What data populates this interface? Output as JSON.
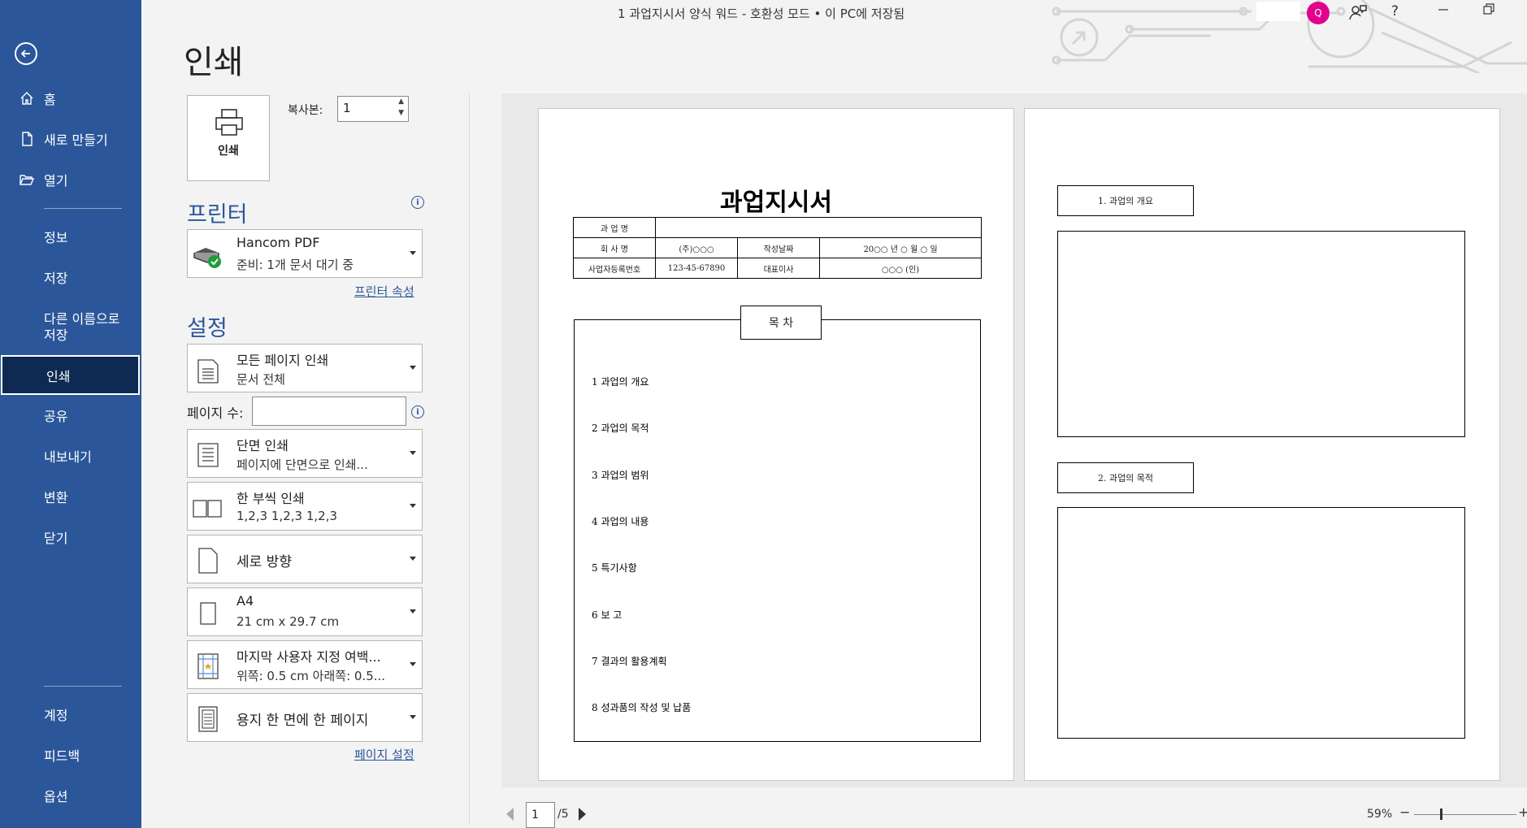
{
  "window": {
    "title": "1 과업지시서 양식 워드  -  호환성 모드 • 이 PC에 저장됨",
    "help_label": "?",
    "avatar_glyph": "Q"
  },
  "sidebar": {
    "items": [
      {
        "label": "홈",
        "icon": "home-icon"
      },
      {
        "label": "새로 만들기",
        "icon": "new-document-icon"
      },
      {
        "label": "열기",
        "icon": "folder-open-icon"
      },
      {
        "label": "정보"
      },
      {
        "label": "저장"
      },
      {
        "label_line1": "다른 이름으로",
        "label_line2": "저장"
      },
      {
        "label": "인쇄",
        "active": true
      },
      {
        "label": "공유"
      },
      {
        "label": "내보내기"
      },
      {
        "label": "변환"
      },
      {
        "label": "닫기"
      },
      {
        "label": "계정"
      },
      {
        "label": "피드백"
      },
      {
        "label": "옵션"
      }
    ]
  },
  "print_panel": {
    "heading": "인쇄",
    "print_button_label": "인쇄",
    "copies_label": "복사본:",
    "copies_value": "1",
    "printer_heading": "프린터",
    "printer_name": "Hancom PDF",
    "printer_status": "준비: 1개 문서 대기 중",
    "printer_properties_link": "프린터 속성",
    "settings_heading": "설정",
    "settings": [
      {
        "line1": "모든 페이지 인쇄",
        "line2": "문서 전체"
      },
      {
        "line1": "단면 인쇄",
        "line2": "페이지에 단면으로 인쇄..."
      },
      {
        "line1": "한 부씩 인쇄",
        "line2": "1,2,3     1,2,3     1,2,3"
      },
      {
        "single": "세로 방향"
      },
      {
        "line1": "A4",
        "line2": "21 cm x 29.7 cm"
      },
      {
        "line1": "마지막 사용자 지정 여백...",
        "line2": "위쪽: 0.5 cm 아래쪽: 0.5..."
      },
      {
        "single": "용지 한 면에 한 페이지"
      }
    ],
    "pages_label": "페이지 수:",
    "pages_value": "",
    "page_setup_link": "페이지 설정"
  },
  "preview": {
    "page1": {
      "title": "과업지시서",
      "table": [
        [
          "과 업 명",
          ""
        ],
        [
          "회 사 명",
          "(주)○○○",
          "작성날짜",
          "20○○ 년    ○ 월    ○ 일"
        ],
        [
          "사업자등록번호",
          "123-45-67890",
          "대표이사",
          "○○○           (인)"
        ]
      ],
      "toc_label": "목 차",
      "toc_items": [
        "1  과업의 개요",
        "2  과업의 목적",
        "3  과업의 범위",
        "4  과업의 내용",
        "5  특기사항",
        "6  보  고",
        "7  결과의 활용계획",
        "8  성과품의 작성 및 납품"
      ]
    },
    "page2": {
      "section1": "1. 과업의 개요",
      "section2": "2. 과업의 목적"
    }
  },
  "status": {
    "current_page": "1",
    "total_pages": "/5",
    "zoom": "59%",
    "zoom_fraction": 0.59
  }
}
